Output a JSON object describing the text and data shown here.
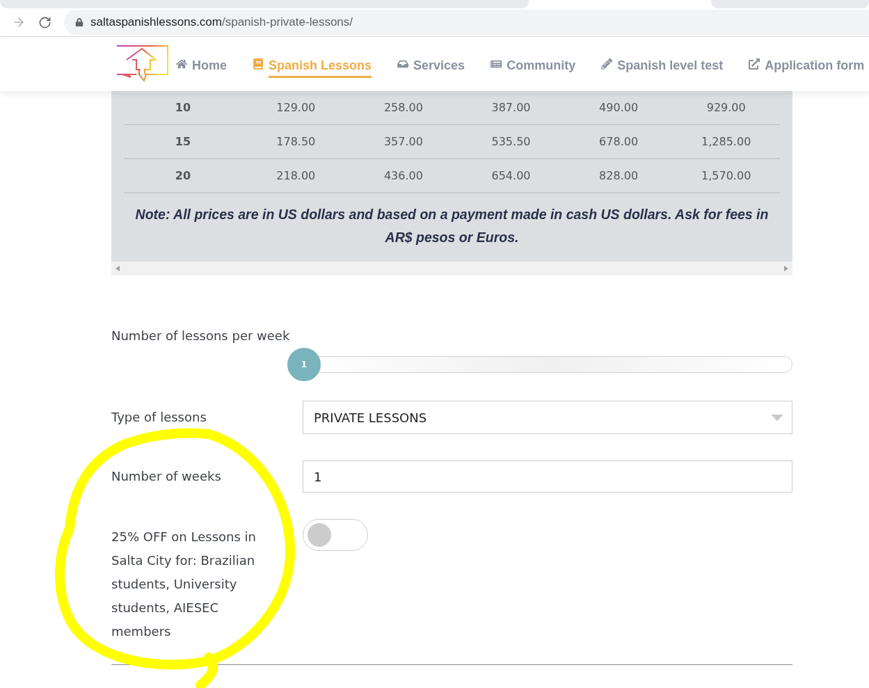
{
  "browser": {
    "url_host": "saltaspanishlessons.com",
    "url_path": "/spanish-private-lessons/",
    "forward_disabled": true
  },
  "nav": {
    "items": [
      {
        "label": "Home",
        "selected": false
      },
      {
        "label": "Spanish Lessons",
        "selected": true
      },
      {
        "label": "Services",
        "selected": false
      },
      {
        "label": "Community",
        "selected": false
      },
      {
        "label": "Spanish level test",
        "selected": false
      },
      {
        "label": "Application form",
        "selected": false
      }
    ]
  },
  "price_table": {
    "rows": [
      [
        "10",
        "129.00",
        "258.00",
        "387.00",
        "490.00",
        "929.00"
      ],
      [
        "15",
        "178.50",
        "357.00",
        "535.50",
        "678.00",
        "1,285.00"
      ],
      [
        "20",
        "218.00",
        "436.00",
        "654.00",
        "828.00",
        "1,570.00"
      ]
    ],
    "note": "Note: All prices are in US dollars and based on a payment made in cash US dollars. Ask for fees in AR$ pesos or Euros."
  },
  "form": {
    "lessons_per_week": {
      "label": "Number of lessons per week",
      "value": "1",
      "level": 0
    },
    "lesson_type": {
      "label": "Type of lessons",
      "value": "PRIVATE LESSONS"
    },
    "weeks": {
      "label": "Number of weeks",
      "value": "1"
    },
    "discount": {
      "label": "25% OFF on Lessons in Salta City for: Brazilian students, University students, AIESEC members",
      "on": false
    }
  }
}
